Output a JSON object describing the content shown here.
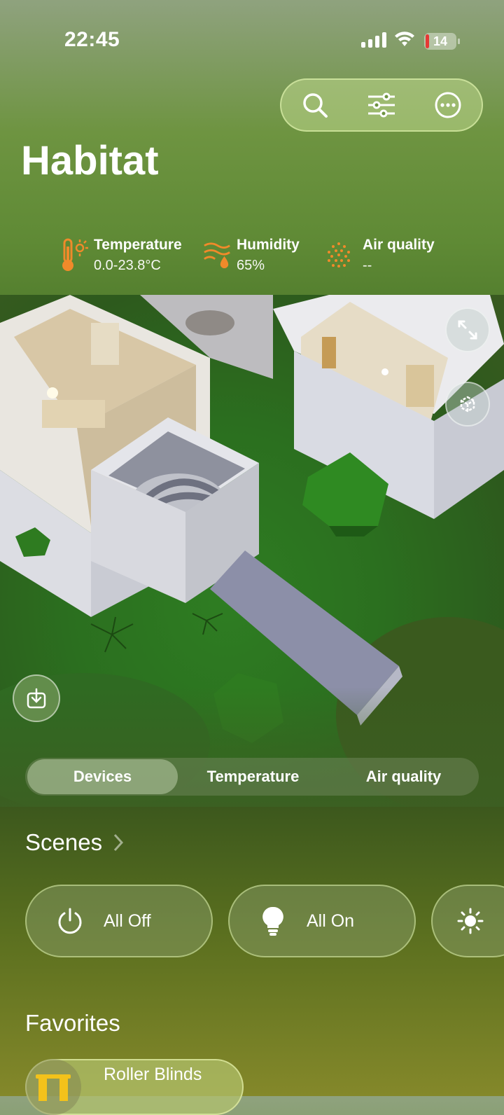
{
  "status": {
    "time": "22:45",
    "battery": "14"
  },
  "header": {
    "title": "Habitat"
  },
  "toolbar": {
    "icons": [
      "search-icon",
      "sliders-icon",
      "more-icon"
    ]
  },
  "environment": {
    "temperature": {
      "label": "Temperature",
      "value": "0.0-23.8°C"
    },
    "humidity": {
      "label": "Humidity",
      "value": "65%"
    },
    "air_quality": {
      "label": "Air quality",
      "value": "--"
    }
  },
  "tabs": [
    {
      "label": "Devices",
      "active": true
    },
    {
      "label": "Temperature",
      "active": false
    },
    {
      "label": "Air quality",
      "active": false
    }
  ],
  "scenes": {
    "title": "Scenes",
    "items": [
      {
        "label": "All Off",
        "icon": "power-icon"
      },
      {
        "label": "All On",
        "icon": "bulb-icon"
      },
      {
        "label": "",
        "icon": "sun-icon"
      }
    ]
  },
  "favorites": {
    "title": "Favorites",
    "items": [
      {
        "label": "Roller Blinds",
        "icon": "blinds-icon"
      }
    ]
  },
  "colors": {
    "accent_orange": "#f08a2a",
    "background_green": "#5f8a35"
  }
}
